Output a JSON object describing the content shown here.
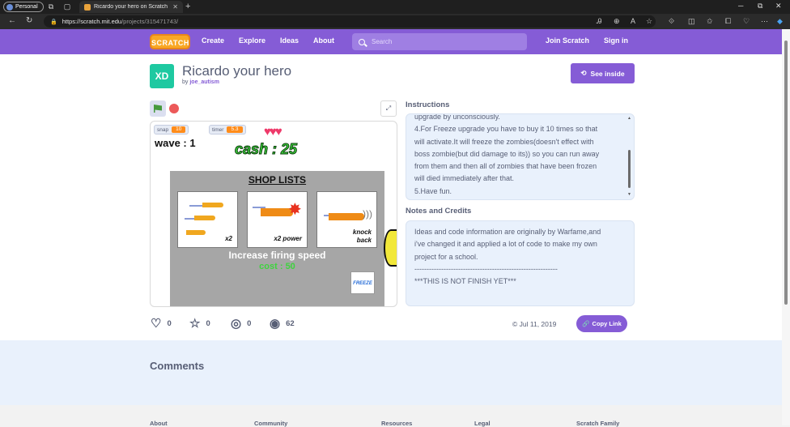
{
  "browser": {
    "profile_label": "Personal",
    "tab_title": "Ricardo your hero on Scratch",
    "url_host": "https://scratch.mit.edu",
    "url_path": "/projects/315471743/"
  },
  "nav": {
    "logo_text": "SCRATCH",
    "create": "Create",
    "explore": "Explore",
    "ideas": "Ideas",
    "about": "About",
    "search_placeholder": "Search",
    "join": "Join Scratch",
    "signin": "Sign in",
    "brand_color": "#855cd6"
  },
  "project": {
    "thumb_text": "XD",
    "title": "Ricardo your hero",
    "by_label": "by",
    "author": "joe_autism",
    "see_inside": "See inside"
  },
  "stage": {
    "monitor_snap_label": "snap",
    "monitor_snap_value": "10",
    "monitor_timer_label": "timer",
    "monitor_timer_value": "5.3",
    "wave_text": "wave : 1",
    "hearts": "♥♥♥",
    "cash_text": "cash : 25",
    "shop_title": "SHOP LISTS",
    "item1_caption": "x2",
    "item2_caption": "x2 power",
    "item3_caption_line1": "knock",
    "item3_caption_line2": "back",
    "shop_caption": "Increase firing speed",
    "shop_cost": "cost : 50",
    "freeze_label": "FREEZE"
  },
  "instructions": {
    "label": "Instructions",
    "lines": [
      "upgrade by unconsciously.",
      "4.For Freeze upgrade you have to buy it 10 times so that",
      "will activate.It will freeze the zombies(doesn't effect with",
      "boss zombie(but did damage to its)) so you can run away",
      "from them and then all of zombies that have been frozen",
      "will died immediately after that.",
      "5.Have fun."
    ]
  },
  "notes": {
    "label": "Notes and Credits",
    "lines": [
      "Ideas and code information are originally by Warfame,and",
      "i've changed it and applied a lot of code to make my own",
      "project for a school.",
      "-----------------------------------------------------------",
      "***THIS IS NOT FINISH YET***"
    ]
  },
  "stats": {
    "loves": "0",
    "favorites": "0",
    "remixes": "0",
    "views": "62",
    "date": "Jul 11, 2019",
    "copy_link": "Copy Link"
  },
  "comments": {
    "title": "Comments"
  },
  "footer": {
    "about": "About",
    "community": "Community",
    "resources": "Resources",
    "legal": "Legal",
    "family": "Scratch Family"
  }
}
